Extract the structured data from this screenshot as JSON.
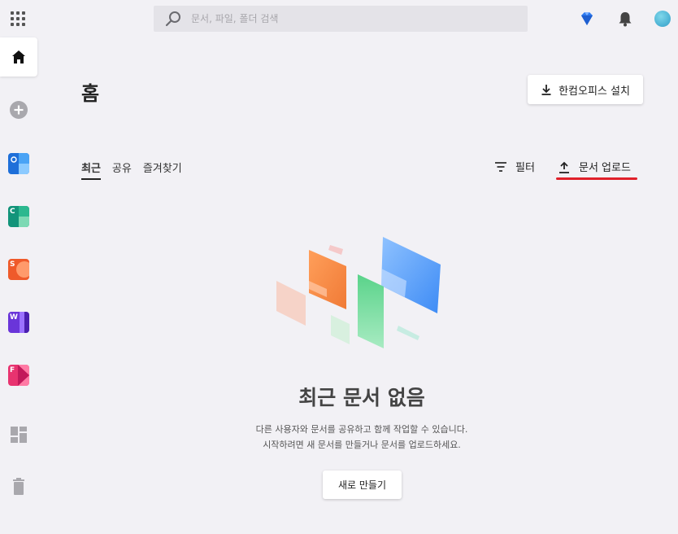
{
  "search": {
    "placeholder": "문서, 파일, 폴더 검색"
  },
  "header": {
    "title": "홈",
    "install_label": "한컴오피스 설치"
  },
  "tabs": [
    {
      "label": "최근",
      "active": true
    },
    {
      "label": "공유",
      "active": false
    },
    {
      "label": "즐겨찾기",
      "active": false
    }
  ],
  "toolbar": {
    "filter_label": "필터",
    "upload_label": "문서 업로드"
  },
  "sidebar": {
    "apps": [
      {
        "letter": "",
        "icon": "docs-app-icon",
        "color": "#1e6fd9"
      },
      {
        "letter": "C",
        "icon": "calc-app-icon",
        "color": "#13947a"
      },
      {
        "letter": "S",
        "icon": "show-app-icon",
        "color": "#ef5a2a"
      },
      {
        "letter": "W",
        "icon": "word-app-icon",
        "color": "#6a35d9"
      },
      {
        "letter": "F",
        "icon": "pdf-app-icon",
        "color": "#e8336f"
      }
    ]
  },
  "empty": {
    "title": "최근 문서 없음",
    "line1": "다른 사용자와 문서를 공유하고 함께 작업할 수 있습니다.",
    "line2": "시작하려면 새 문서를 만들거나 문서를 업로드하세요.",
    "new_label": "새로 만들기"
  },
  "colors": {
    "accent_underline": "#e0202a",
    "background": "#f2f1f5"
  }
}
